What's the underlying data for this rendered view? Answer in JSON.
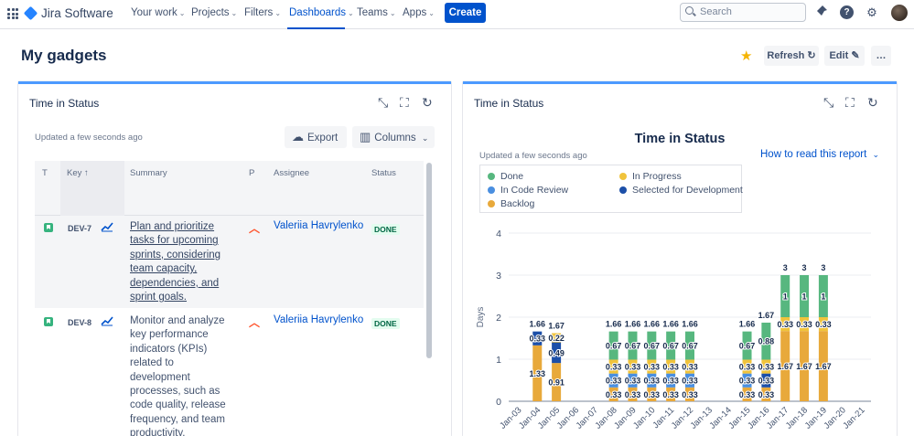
{
  "topnav": {
    "app_name": "Jira Software",
    "items": [
      {
        "label": "Your work",
        "active": false
      },
      {
        "label": "Projects",
        "active": false
      },
      {
        "label": "Filters",
        "active": false
      },
      {
        "label": "Dashboards",
        "active": true
      },
      {
        "label": "Teams",
        "active": false
      },
      {
        "label": "Apps",
        "active": false
      }
    ],
    "create_label": "Create",
    "search_placeholder": "Search",
    "icons": [
      "apps-grid-icon",
      "notifications-icon",
      "help-icon",
      "settings-icon",
      "profile-avatar"
    ]
  },
  "page": {
    "title": "My gadgets",
    "refresh_label": "Refresh",
    "edit_label": "Edit",
    "more_label": "…",
    "star_color": "#f5b400"
  },
  "gadget_left": {
    "title": "Time in Status",
    "updated": "Updated a few seconds ago",
    "export_label": "Export",
    "columns_label": "Columns",
    "columns": [
      "T",
      "Key ↑",
      "Summary",
      "P",
      "Assignee",
      "Status"
    ],
    "rows": [
      {
        "key": "DEV-7",
        "summary": "Plan and prioritize tasks for upcoming sprints, considering team capacity, dependencies, and sprint goals.",
        "assignee": "Valeriia Havrylenko",
        "status": "DONE"
      },
      {
        "key": "DEV-8",
        "summary": "Monitor and analyze key performance indicators (KPIs) related to development processes, such as code quality, release frequency, and team productivity.",
        "assignee": "Valeriia Havrylenko",
        "status": "DONE"
      }
    ]
  },
  "gadget_right": {
    "title": "Time in Status",
    "updated": "Updated a few seconds ago",
    "how_to_read": "How to read this report",
    "legend": [
      {
        "label": "Done",
        "color": "#57b77f"
      },
      {
        "label": "In Progress",
        "color": "#f0c33c"
      },
      {
        "label": "In Code Review",
        "color": "#4a8fe0"
      },
      {
        "label": "Selected for Development",
        "color": "#1c4fa8"
      },
      {
        "label": "Backlog",
        "color": "#e8a93b"
      }
    ]
  },
  "chart_data": {
    "type": "bar",
    "stacked": true,
    "title": "Time in Status",
    "ylabel": "Days",
    "xlabel": "",
    "ylim": [
      0,
      4
    ],
    "yticks": [
      0,
      1,
      2,
      3,
      4
    ],
    "grid": true,
    "legend_position": "top-left",
    "categories": [
      "Jan-03",
      "Jan-04",
      "Jan-05",
      "Jan-06",
      "Jan-07",
      "Jan-08",
      "Jan-09",
      "Jan-10",
      "Jan-11",
      "Jan-12",
      "Jan-13",
      "Jan-14",
      "Jan-15",
      "Jan-16",
      "Jan-17",
      "Jan-18",
      "Jan-19",
      "Jan-20",
      "Jan-21"
    ],
    "series": [
      {
        "name": "Backlog",
        "color": "#e8a93b",
        "values": [
          0,
          1.33,
          0.91,
          0,
          0,
          0.33,
          0.33,
          0.33,
          0.33,
          0.33,
          0,
          0,
          0.33,
          0.33,
          1.67,
          1.67,
          1.67,
          0,
          0
        ]
      },
      {
        "name": "In Code Review",
        "color": "#4a8fe0",
        "values": [
          0,
          0,
          0,
          0,
          0,
          0.33,
          0.33,
          0.33,
          0.33,
          0.33,
          0,
          0,
          0.33,
          0,
          0,
          0,
          0,
          0,
          0
        ]
      },
      {
        "name": "Selected for Development",
        "color": "#1c4fa8",
        "values": [
          0,
          0.33,
          0.49,
          0,
          0,
          0,
          0,
          0,
          0,
          0,
          0,
          0,
          0,
          0.33,
          0,
          0,
          0,
          0,
          0
        ]
      },
      {
        "name": "In Progress",
        "color": "#f0c33c",
        "values": [
          0,
          0,
          0.22,
          0,
          0,
          0.33,
          0.33,
          0.33,
          0.33,
          0.33,
          0,
          0,
          0.33,
          0.33,
          0.33,
          0.33,
          0.33,
          0,
          0
        ]
      },
      {
        "name": "Done",
        "color": "#57b77f",
        "values": [
          0,
          0,
          0,
          0,
          0,
          0.67,
          0.67,
          0.67,
          0.67,
          0.67,
          0,
          0,
          0.67,
          0.88,
          1,
          1,
          1,
          0,
          0
        ]
      }
    ],
    "totals": [
      null,
      1.66,
      1.67,
      null,
      null,
      1.66,
      1.66,
      1.66,
      1.66,
      1.66,
      null,
      null,
      1.66,
      1.67,
      3,
      3,
      3,
      null,
      null
    ]
  }
}
